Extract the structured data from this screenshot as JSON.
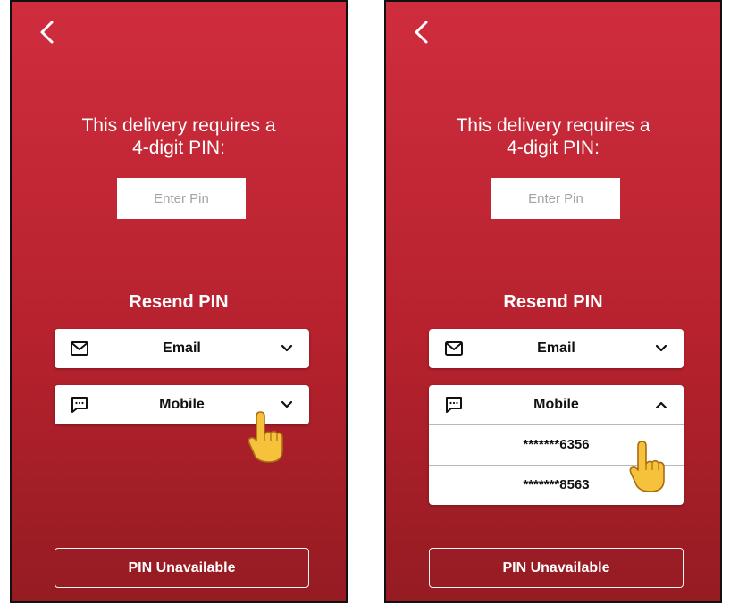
{
  "screens": [
    {
      "back_icon": "chevron-left-icon",
      "title_line1": "This delivery requires a",
      "title_line2": "4-digit PIN:",
      "pin_placeholder": "Enter Pin",
      "resend_label": "Resend PIN",
      "email": {
        "label": "Email",
        "icon": "envelope-icon",
        "chevron": "chevron-down-icon"
      },
      "mobile": {
        "label": "Mobile",
        "icon": "message-icon",
        "chevron": "chevron-down-icon",
        "expanded": false
      },
      "pin_unavailable_label": "PIN Unavailable"
    },
    {
      "back_icon": "chevron-left-icon",
      "title_line1": "This delivery requires a",
      "title_line2": "4-digit PIN:",
      "pin_placeholder": "Enter Pin",
      "resend_label": "Resend PIN",
      "email": {
        "label": "Email",
        "icon": "envelope-icon",
        "chevron": "chevron-down-icon"
      },
      "mobile": {
        "label": "Mobile",
        "icon": "message-icon",
        "chevron": "chevron-up-icon",
        "expanded": true,
        "options": [
          "*******6356",
          "*******8563"
        ]
      },
      "pin_unavailable_label": "PIN Unavailable"
    }
  ],
  "colors": {
    "background_top": "#cf2d3e",
    "background_bottom": "#951b22",
    "text_on_bg": "#ffffff",
    "card": "#ffffff"
  }
}
